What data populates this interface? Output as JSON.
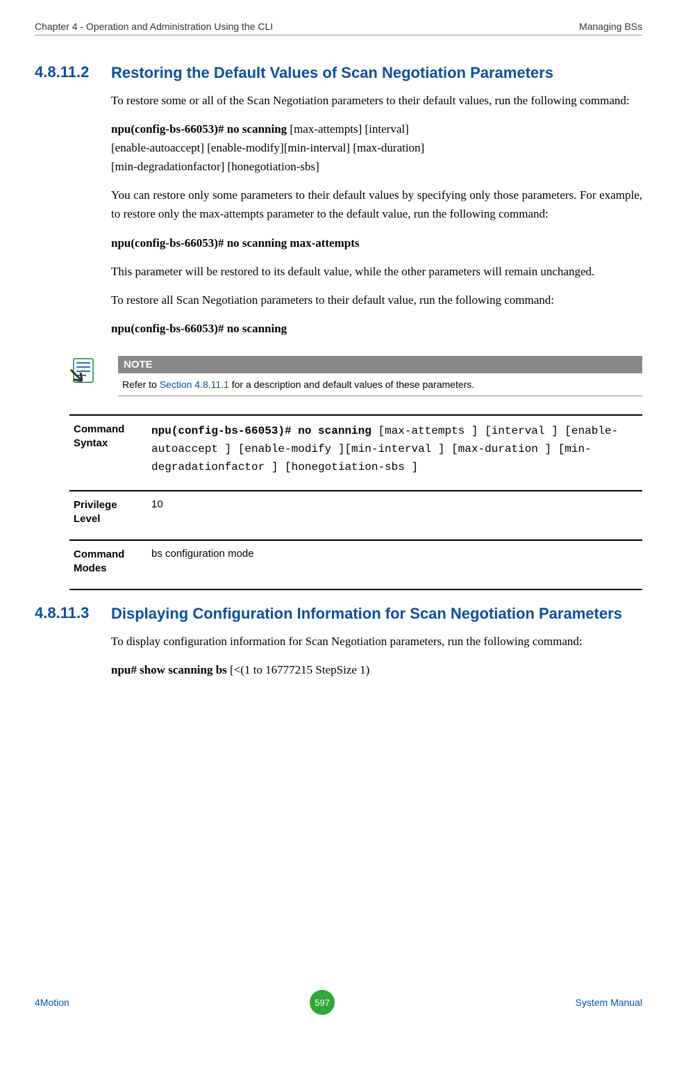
{
  "header": {
    "left": "Chapter 4 - Operation and Administration Using the CLI",
    "right": "Managing BSs"
  },
  "section1": {
    "num": "4.8.11.2",
    "title": "Restoring the Default Values of Scan Negotiation Parameters",
    "p1": "To restore some or all of the Scan Negotiation parameters to their default values, run the following command:",
    "cmd1_bold": "npu(config-bs-66053)# no scanning",
    "cmd1_rest_l1": " [max-attempts] [interval]",
    "cmd1_rest_l2": "[enable-autoaccept] [enable-modify][min-interval] [max-duration]",
    "cmd1_rest_l3": "[min-degradationfactor] [honegotiation-sbs]",
    "p2": "You can restore only some parameters to their default values by specifying only those parameters. For example, to restore only the max-attempts parameter to the default value, run the following command:",
    "cmd2": "npu(config-bs-66053)# no scanning max-attempts",
    "p3": "This parameter will be restored to its default value, while the other parameters will remain unchanged.",
    "p4": "To restore all Scan Negotiation parameters to their default value, run the following command:",
    "cmd3": "npu(config-bs-66053)# no scanning"
  },
  "note": {
    "label": "NOTE",
    "pre": "Refer to ",
    "link": "Section 4.8.11.1",
    "post": " for a description and default values of these parameters."
  },
  "table": {
    "row1_label": "Command Syntax",
    "row1_bold": "npu(config-bs-66053)# no scanning",
    "row1_rest": " [max-attempts ] [interval ] [enable-autoaccept ] [enable-modify ][min-interval ] [max-duration ] [min-degradationfactor ] [honegotiation-sbs ]",
    "row2_label": "Privilege Level",
    "row2_value": "10",
    "row3_label": "Command Modes",
    "row3_value": "bs configuration mode"
  },
  "section2": {
    "num": "4.8.11.3",
    "title": "Displaying Configuration Information for Scan Negotiation Parameters",
    "p1": "To display configuration information for Scan Negotiation parameters, run the following command:",
    "cmd_bold": "npu# show scanning bs",
    "cmd_rest": " [<(1 to 16777215 StepSize 1)"
  },
  "footer": {
    "left": "4Motion",
    "page": "597",
    "right": "System Manual"
  }
}
